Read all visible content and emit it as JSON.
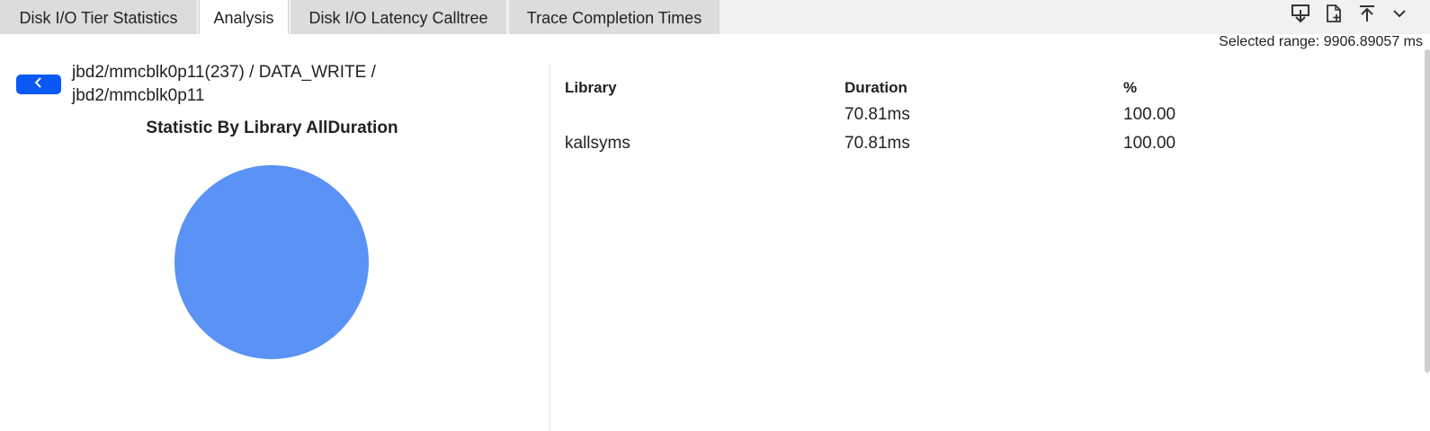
{
  "tabs": [
    {
      "label": "Disk I/O Tier Statistics",
      "active": false
    },
    {
      "label": "Analysis",
      "active": true
    },
    {
      "label": "Disk I/O Latency Calltree",
      "active": false
    },
    {
      "label": "Trace Completion Times",
      "active": false
    }
  ],
  "toolbar": {
    "icons": [
      "download-icon",
      "file-add-icon",
      "pin-top-icon",
      "chevron-down-icon"
    ]
  },
  "selected_range": "Selected range: 9906.89057 ms",
  "breadcrumb": "jbd2/mmcblk0p11(237) / DATA_WRITE / jbd2/mmcblk0p11",
  "back_icon": "chevron-left-icon",
  "chart_data": {
    "type": "pie",
    "title": "Statistic By Library AllDuration",
    "categories": [
      "kallsyms"
    ],
    "values": [
      100.0
    ],
    "colors": [
      "#5b92f5"
    ]
  },
  "table": {
    "headers": {
      "library": "Library",
      "duration": "Duration",
      "percent": "%"
    },
    "rows": [
      {
        "library": "",
        "duration": "70.81ms",
        "percent": "100.00"
      },
      {
        "library": "kallsyms",
        "duration": "70.81ms",
        "percent": "100.00"
      }
    ]
  },
  "colors": {
    "accent": "#0a59f7",
    "pie": "#5b92f5",
    "tab_inactive": "#dcdcdc",
    "tabbar_bg": "#f1f1f1"
  }
}
